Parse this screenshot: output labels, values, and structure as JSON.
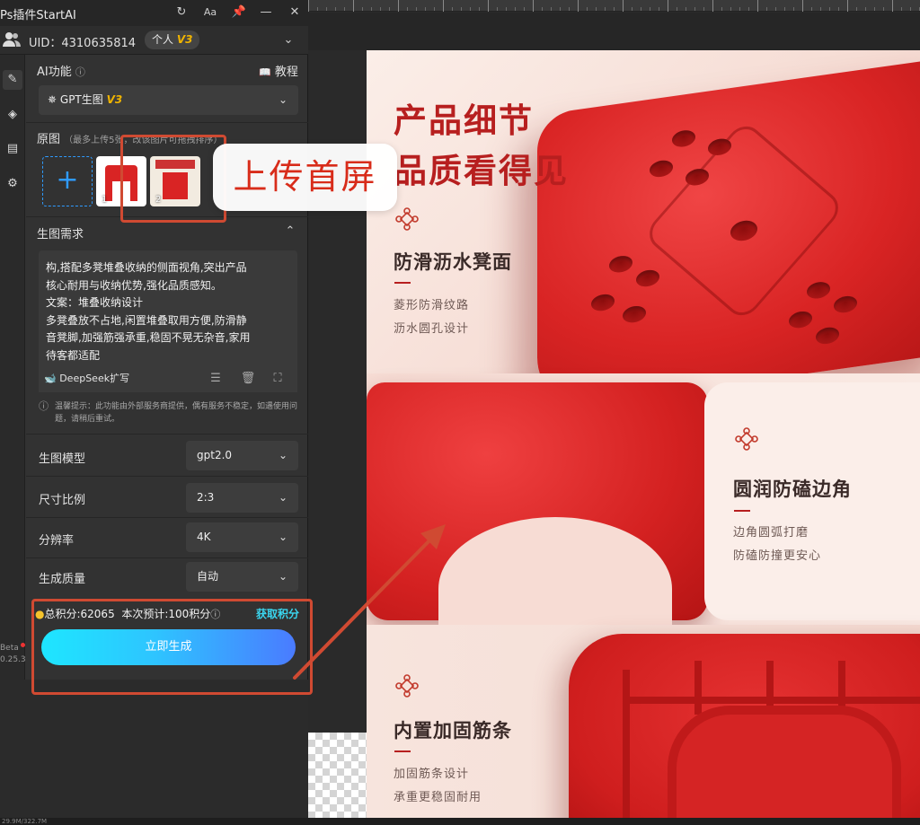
{
  "app": {
    "title": "Ps插件StartAI",
    "uid_label": "UID：4310635814",
    "plan_badge": "个人",
    "plan_version": "V3",
    "version_beta": "Beta",
    "version_number": "0.25.3"
  },
  "titlebar_icons": [
    "refresh-icon",
    "font-size-icon",
    "pin-icon",
    "minimize-icon",
    "close-icon"
  ],
  "sidebar_icons": [
    "pencil-icon",
    "layers-icon",
    "clipboard-icon",
    "gear-icon"
  ],
  "ai": {
    "section_label": "AI功能",
    "tutorial_label": "教程",
    "model_select": "GPT生图",
    "model_version": "V3"
  },
  "source": {
    "label": "原图",
    "hint": "（最多上传5张，改该图片可拖拽排序）",
    "thumbs": [
      {
        "num": "1"
      },
      {
        "num": "2"
      }
    ]
  },
  "prompt": {
    "section_label": "生图需求",
    "text_lines": [
      "构,搭配多凳堆叠收纳的侧面视角,突出产品",
      "核心耐用与收纳优势,强化品质感知。",
      "文案：堆叠收纳设计",
      "多凳叠放不占地,闲置堆叠取用方便,防滑静",
      "音凳脚,加强筋强承重,稳固不晃无杂音,家用",
      "待客都适配"
    ],
    "deepseek_label": "DeepSeek扩写",
    "tip": "温馨提示：此功能由外部服务商提供，偶有服务不稳定，如遇使用问题，请稍后重试。"
  },
  "options": [
    {
      "label": "生图模型",
      "value": "gpt2.0"
    },
    {
      "label": "尺寸比例",
      "value": "2:3"
    },
    {
      "label": "分辨率",
      "value": "4K"
    },
    {
      "label": "生成质量",
      "value": "自动"
    }
  ],
  "score": {
    "total": "总积分:62065",
    "estimate": "本次预计:100积分",
    "get_points": "获取积分"
  },
  "generate_label": "立即生成",
  "annotation": {
    "callout_text": "上传首屏"
  },
  "poster": {
    "headline_1": "产品细节",
    "headline_2": "品质看得见",
    "features": [
      {
        "title": "防滑沥水凳面",
        "sub_1": "菱形防滑纹路",
        "sub_2": "沥水圆孔设计"
      },
      {
        "title": "圆润防磕边角",
        "sub_1": "边角圆弧打磨",
        "sub_2": "防磕防撞更安心"
      },
      {
        "title": "内置加固筋条",
        "sub_1": "加固筋条设计",
        "sub_2": "承重更稳固耐用"
      }
    ],
    "accent_color": "#b71f1f"
  },
  "status_bar": "29.9M/322.7M"
}
